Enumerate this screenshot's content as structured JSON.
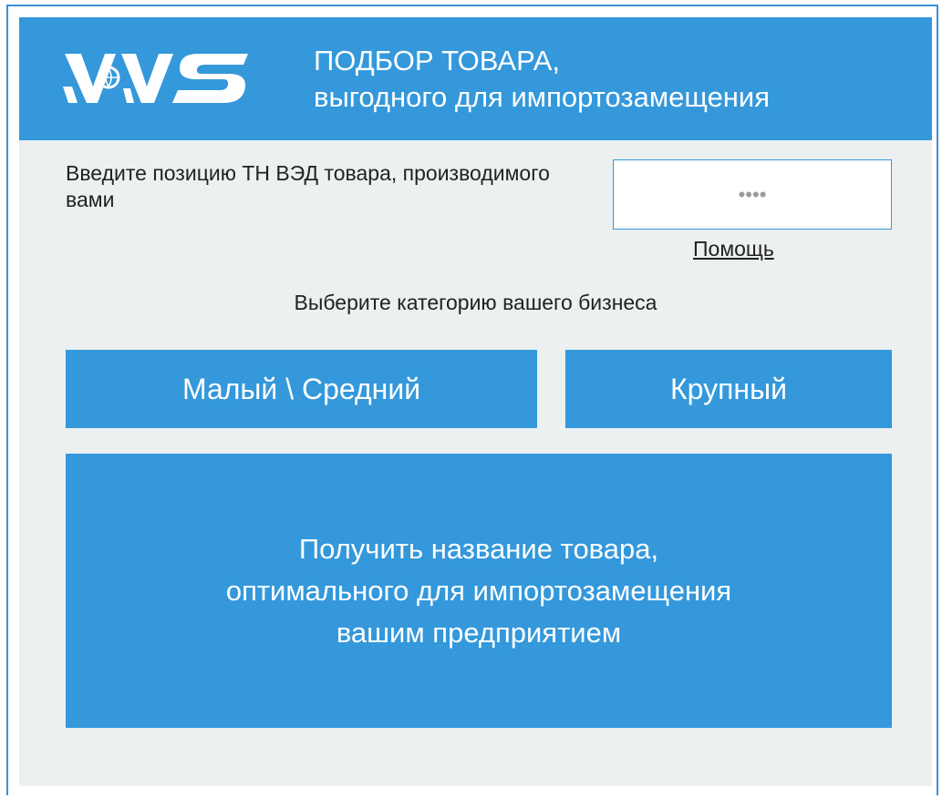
{
  "header": {
    "logo_text": "VVS",
    "title_line1": "ПОДБОР ТОВАРА,",
    "title_line2": "выгодного для импортозамещения"
  },
  "form": {
    "hs_label": "Введите позицию ТН ВЭД товара, производимого вами",
    "hs_placeholder": "••••",
    "help_link": "Помощь",
    "category_label": "Выберите категорию вашего бизнеса"
  },
  "buttons": {
    "small_medium": "Малый \\ Средний",
    "large": "Крупный",
    "get_line1": "Получить название товара,",
    "get_line2": "оптимального для импортозамещения",
    "get_line3": "вашим предприятием"
  },
  "colors": {
    "accent": "#3498db",
    "background": "#ecf0f1",
    "text": "#222222"
  }
}
